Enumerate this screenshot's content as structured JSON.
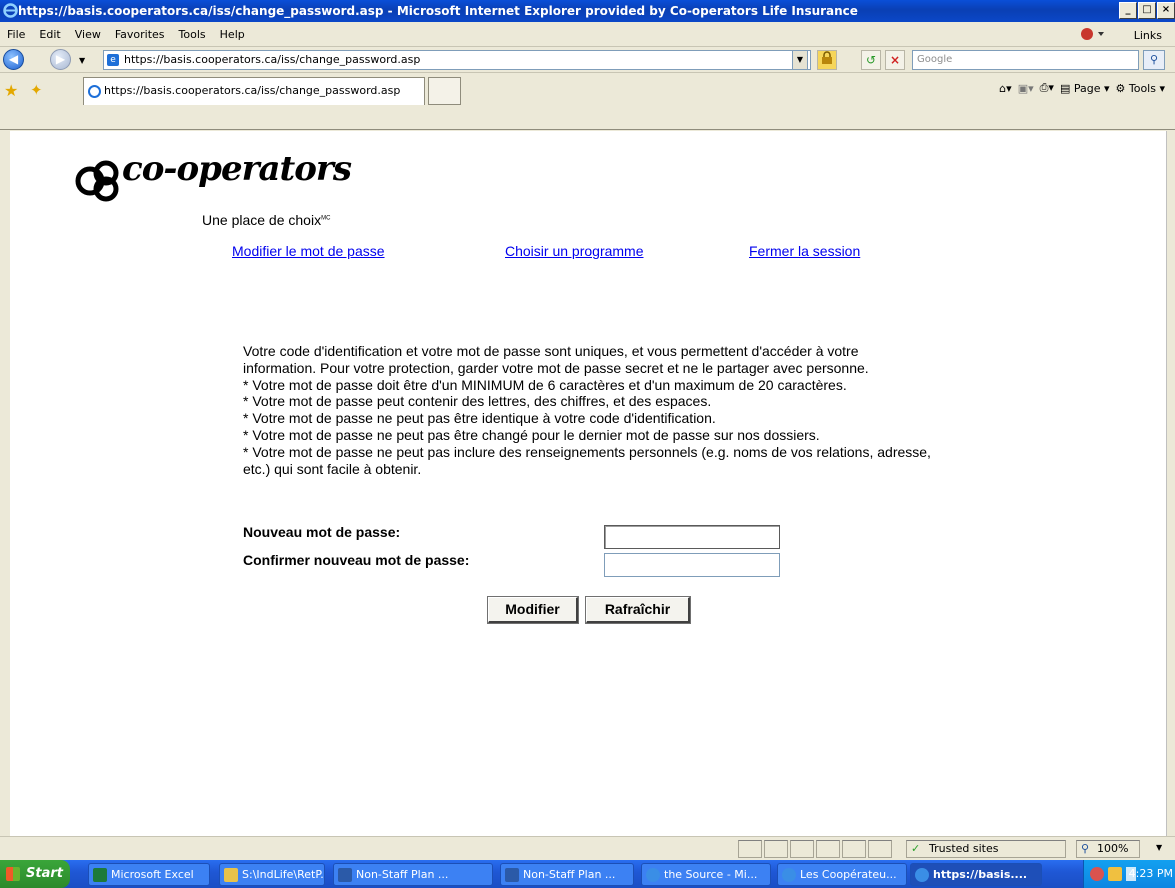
{
  "window": {
    "title": "https://basis.cooperators.ca/iss/change_password.asp - Microsoft Internet Explorer provided by Co-operators Life Insurance",
    "controls": [
      "_",
      "□",
      "×"
    ]
  },
  "menu": {
    "items": [
      "File",
      "Edit",
      "View",
      "Favorites",
      "Tools",
      "Help"
    ],
    "links_label": "Links"
  },
  "address_bar": {
    "url": "https://basis.cooperators.ca/iss/change_password.asp",
    "search_placeholder": "Google"
  },
  "tab": {
    "title": "https://basis.cooperators.ca/iss/change_password.asp"
  },
  "command_bar": {
    "page_label": "Page",
    "tools_label": "Tools"
  },
  "page": {
    "logo_text": "co-operators",
    "logo_tagline": "Une place de choix",
    "logo_mark": "MC",
    "nav": {
      "change_password": "Modifier le mot de passe",
      "choose_program": "Choisir un programme",
      "logout": "Fermer la session"
    },
    "info_lines": [
      "Votre code d'identification et votre mot de passe sont uniques, et vous permettent d'accéder à votre information. Pour votre protection, garder votre mot de passe secret et ne le partager avec personne.",
      "* Votre mot de passe doit être d'un MINIMUM de 6 caractères et d'un maximum de 20 caractères.",
      "* Votre mot de passe peut contenir des lettres, des chiffres, et des espaces.",
      "* Votre mot de passe ne peut pas être identique à votre code d'identification.",
      "* Votre mot de passe ne peut pas être changé pour le dernier mot de passe sur nos dossiers.",
      "* Votre mot de passe ne peut pas inclure des renseignements personnels (e.g. noms de vos relations, adresse, etc.) qui sont facile à obtenir."
    ],
    "form": {
      "new_password_label": "Nouveau mot de passe:",
      "new_password_value": "",
      "confirm_password_label": "Confirmer nouveau mot de passe:",
      "confirm_password_value": "",
      "submit_label": "Modifier",
      "reset_label": "Rafraîchir"
    }
  },
  "status_bar": {
    "zone": "Trusted sites",
    "zoom": "100%"
  },
  "taskbar": {
    "start_label": "Start",
    "tasks": [
      {
        "label": "Microsoft Excel",
        "icon": "excel-icon",
        "color": "#1d7a3a"
      },
      {
        "label": "S:\\IndLife\\RetP...",
        "icon": "folder-icon",
        "color": "#e8c24a"
      },
      {
        "label": "Non-Staff Plan ...",
        "icon": "word-icon",
        "color": "#2b5aa8"
      },
      {
        "label": "Non-Staff Plan ...",
        "icon": "word-icon",
        "color": "#2b5aa8"
      },
      {
        "label": "the Source - Mi...",
        "icon": "ie-icon",
        "color": "#3a8ee6"
      },
      {
        "label": "Les Coopérateu...",
        "icon": "ie-icon",
        "color": "#3a8ee6"
      },
      {
        "label": "https://basis....",
        "icon": "ie-icon",
        "color": "#3a8ee6",
        "active": true
      }
    ],
    "clock": "4:23 PM"
  }
}
